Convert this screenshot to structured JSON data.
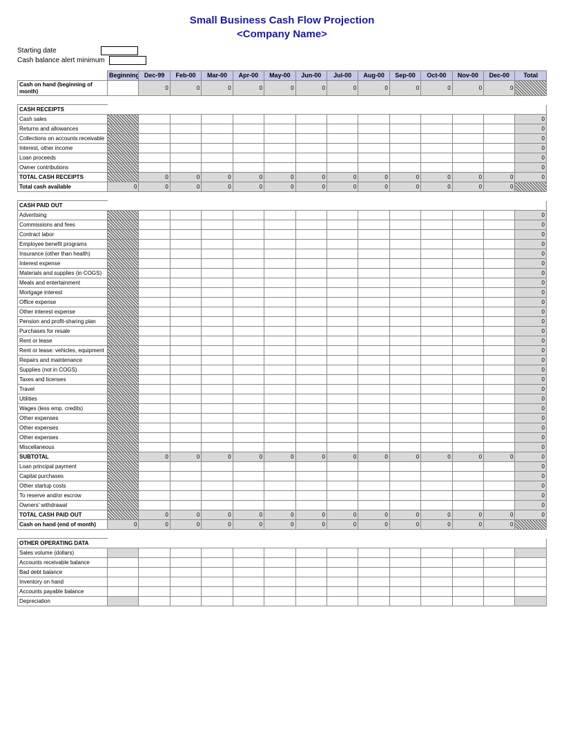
{
  "title": {
    "line1": "Small Business Cash Flow Projection",
    "line2": "<Company Name>"
  },
  "meta": {
    "starting_date": "Starting date",
    "cash_balance_alert": "Cash balance alert minimum"
  },
  "headers": [
    "Beginning",
    "Dec-99",
    "Feb-00",
    "Mar-00",
    "Apr-00",
    "May-00",
    "Jun-00",
    "Jul-00",
    "Aug-00",
    "Sep-00",
    "Oct-00",
    "Nov-00",
    "Dec-00",
    "Total"
  ],
  "rows": {
    "cash_on_hand_start": "Cash on hand (beginning of month)",
    "cash_receipts_header": "CASH RECEIPTS",
    "cash_sales": "Cash sales",
    "returns": "Returns and allowances",
    "collections": "Collections on accounts receivable",
    "interest_income": "Interest, other income",
    "loan_proceeds": "Loan proceeds",
    "owner_contrib": "Owner contributions",
    "total_receipts": "TOTAL CASH RECEIPTS",
    "total_cash_available": "Total cash available",
    "cash_paid_header": "CASH PAID OUT",
    "advertising": "Advertising",
    "commissions": "Commissions and fees",
    "contract_labor": "Contract labor",
    "emp_benefit": "Employee benefit programs",
    "insurance": "Insurance (other than health)",
    "interest_expense": "Interest expense",
    "materials": "Materials and supplies (in COGS)",
    "meals": "Meals and entertainment",
    "mortgage": "Mortgage interest",
    "office": "Office expense",
    "other_interest": "Other interest expense",
    "pension": "Pension and profit-sharing plan",
    "purchases_resale": "Purchases for resale",
    "rent_lease": "Rent or lease",
    "rent_vehicles": "Rent or lease: vehicles, equipment",
    "repairs": "Repairs and maintenance",
    "supplies": "Supplies (not in COGS)",
    "taxes": "Taxes and licenses",
    "travel": "Travel",
    "utilities": "Utilities",
    "wages": "Wages (less emp. credits)",
    "other1": "Other expenses",
    "other2": "Other expenses",
    "other3": "Other expenses",
    "misc": "Miscellaneous",
    "subtotal": "SUBTOTAL",
    "loan_principal": "Loan principal payment",
    "capital_purch": "Capital purchases",
    "startup_costs": "Other startup costs",
    "reserve": "To reserve and/or escrow",
    "owners_withdrawal": "Owners' withdrawal",
    "total_paid_out": "TOTAL CASH PAID OUT",
    "cash_on_hand_end": "Cash on hand (end of month)",
    "other_op_header": "OTHER OPERATING DATA",
    "sales_volume": "Sales volume (dollars)",
    "ar_balance": "Accounts receivable balance",
    "bad_debt": "Bad debt balance",
    "inventory": "Inventory on hand",
    "ap_balance": "Accounts payable balance",
    "depreciation": "Depreciation"
  },
  "zero": "0"
}
